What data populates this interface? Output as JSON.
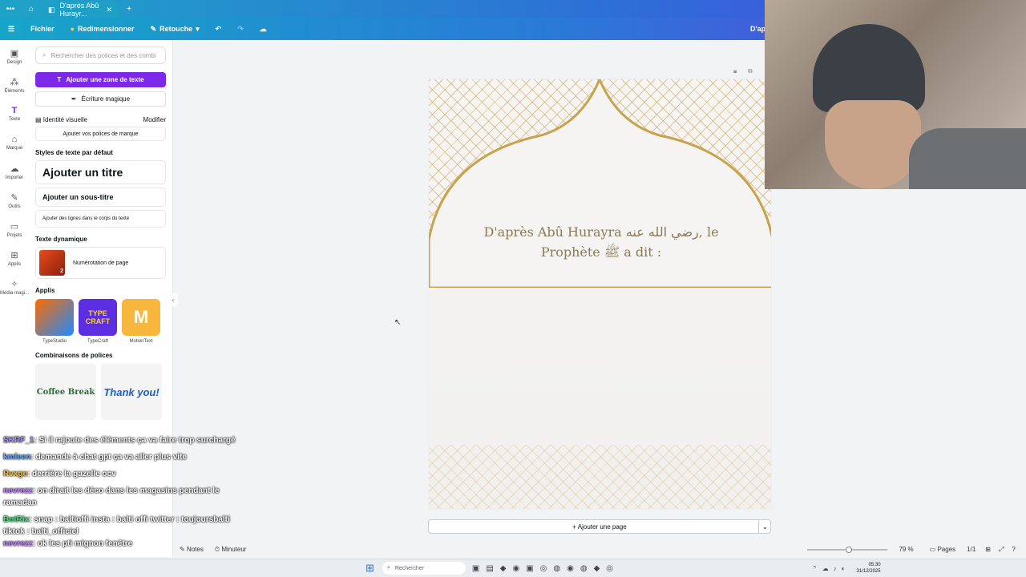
{
  "browser": {
    "tab_title": "D'après Abû Hurayr...",
    "new_tab": "+"
  },
  "topbar": {
    "menu": "Fichier",
    "resize": "Redimensionner",
    "retouch": "Retouche",
    "right_text": "D'apr"
  },
  "rail": [
    {
      "label": "Design",
      "icon": "design-icon",
      "glyph": "▣"
    },
    {
      "label": "Éléments",
      "icon": "elements-icon",
      "glyph": "⁂"
    },
    {
      "label": "Texte",
      "icon": "text-icon",
      "glyph": "T"
    },
    {
      "label": "Marque",
      "icon": "brand-icon",
      "glyph": "⌂"
    },
    {
      "label": "Importer",
      "icon": "upload-icon",
      "glyph": "☁"
    },
    {
      "label": "Outils",
      "icon": "tools-icon",
      "glyph": "✎"
    },
    {
      "label": "Projets",
      "icon": "folder-icon",
      "glyph": "▭"
    },
    {
      "label": "Applis",
      "icon": "apps-icon",
      "glyph": "⊞"
    },
    {
      "label": "Média magi...",
      "icon": "magic-media-icon",
      "glyph": "✧"
    }
  ],
  "panel": {
    "search_placeholder": "Rechercher des polices et des combi",
    "add_textbox": "Ajouter une zone de texte",
    "magic_writing": "Écriture magique",
    "brand_identity": "Identité visuelle",
    "modify": "Modifier",
    "add_brand_fonts": "Ajouter vos polices de marque",
    "default_styles": "Styles de texte par défaut",
    "add_title": "Ajouter un titre",
    "add_subtitle": "Ajouter un sous-titre",
    "add_body": "Ajouter des lignes dans le corps du texte",
    "dynamic_text": "Texte dynamique",
    "page_numbering": "Numérotation de page",
    "apps_heading": "Applis",
    "apps": [
      {
        "name": "TypeStudio",
        "tile": ""
      },
      {
        "name": "TypeCraft",
        "tile": "TYPE CRAFT"
      },
      {
        "name": "MotionText",
        "tile": "M"
      }
    ],
    "font_combos": "Combinaisons de polices",
    "combos": [
      "Coffee Break",
      "Thank you!"
    ]
  },
  "canvas": {
    "quote_line1": "D'après Abû Hurayra رضي الله عنه, le",
    "quote_line2": "Prophète ﷺ a dit :"
  },
  "add_page": "+ Ajouter une page",
  "bottom": {
    "notes": "Notes",
    "timer": "Minuteur",
    "zoom": "79 %",
    "pages": "Pages",
    "page_count": "1/1"
  },
  "taskbar": {
    "search": "Rechercher",
    "time": "05:30",
    "date": "31/12/2025"
  },
  "chat": [
    {
      "user": "SKRF_1",
      "msg": "Si il rajoute des éléments ça va faire trop surchargé"
    },
    {
      "user": "kmleen",
      "msg": "demande à chat gpt ça va aller plus vite"
    },
    {
      "user": "Rvxge",
      "msg": "derrière la gazelle ocv"
    },
    {
      "user": "nevrezz",
      "msg": "on dirait les déco dans les magasins pendant le ramadan"
    },
    {
      "user": "BotRix",
      "msg": "snap : baltioffi insta : balti offi twitter : toujoursbalti tiktok : balti_officiel"
    },
    {
      "user": "nevrezz",
      "msg": "ok les pti mignon fenêtre"
    }
  ]
}
